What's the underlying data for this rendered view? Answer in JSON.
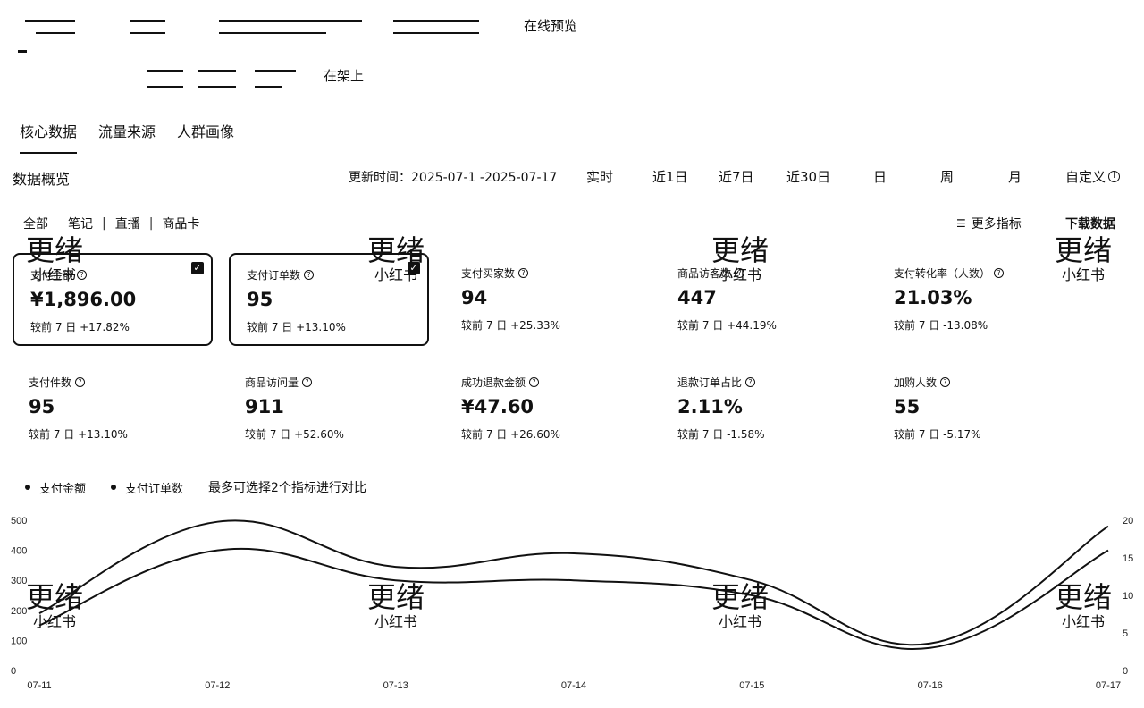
{
  "header": {
    "preview_label": "在线预览",
    "status_label": "在架上"
  },
  "tabs": [
    {
      "label": "核心数据",
      "active": true
    },
    {
      "label": "流量来源",
      "active": false
    },
    {
      "label": "人群画像",
      "active": false
    }
  ],
  "overview": {
    "title": "数据概览",
    "update_time": "更新时间：2025-07-1  -2025-07-17",
    "ranges": [
      "实时",
      "近1日",
      "近7日",
      "近30日",
      "日",
      "周",
      "月",
      "自定义"
    ]
  },
  "filters": [
    "全部",
    "笔记",
    "直播",
    "商品卡"
  ],
  "actions": {
    "more_metrics": "更多指标",
    "download": "下载数据"
  },
  "metrics": [
    {
      "name": "支付金额",
      "value": "¥1,896.00",
      "compare": "较前 7 日  +17.82%",
      "selected": true
    },
    {
      "name": "支付订单数",
      "value": "95",
      "compare": "较前 7 日  +13.10%",
      "selected": true
    },
    {
      "name": "支付买家数",
      "value": "94",
      "compare": "较前 7 日  +25.33%",
      "selected": false
    },
    {
      "name": "商品访客数",
      "value": "447",
      "compare": "较前 7 日  +44.19%",
      "selected": false
    },
    {
      "name": "支付转化率（人数）",
      "value": "21.03%",
      "compare": "较前 7 日  -13.08%",
      "selected": false
    },
    {
      "name": "支付件数",
      "value": "95",
      "compare": "较前 7 日  +13.10%",
      "selected": false
    },
    {
      "name": "商品访问量",
      "value": "911",
      "compare": "较前 7 日  +52.60%",
      "selected": false
    },
    {
      "name": "成功退款金额",
      "value": "¥47.60",
      "compare": "较前 7 日  +26.60%",
      "selected": false
    },
    {
      "name": "退款订单占比",
      "value": "2.11%",
      "compare": "较前 7 日  -1.58%",
      "selected": false
    },
    {
      "name": "加购人数",
      "value": "55",
      "compare": "较前 7 日  -5.17%",
      "selected": false
    }
  ],
  "legend": {
    "items": [
      "支付金额",
      "支付订单数"
    ],
    "hint": "最多可选择2个指标进行对比"
  },
  "watermark": {
    "big": "更绪",
    "small": "小红书"
  },
  "chart_data": {
    "type": "line",
    "x": [
      "07-11",
      "07-12",
      "07-13",
      "07-14",
      "07-15",
      "07-16",
      "07-17"
    ],
    "y_left_ticks": [
      "500",
      "400",
      "300",
      "200",
      "100",
      "0"
    ],
    "y_right_ticks": [
      "20",
      "15",
      "10",
      "5",
      "0"
    ],
    "ylim_left": [
      0,
      500
    ],
    "ylim_right": [
      0,
      20
    ],
    "series": [
      {
        "name": "支付金额",
        "axis": "left",
        "values": [
          190,
          495,
          345,
          390,
          300,
          90,
          480
        ]
      },
      {
        "name": "支付订单数",
        "axis": "right",
        "values": [
          6,
          16,
          12,
          12,
          10,
          3,
          16
        ]
      }
    ]
  }
}
